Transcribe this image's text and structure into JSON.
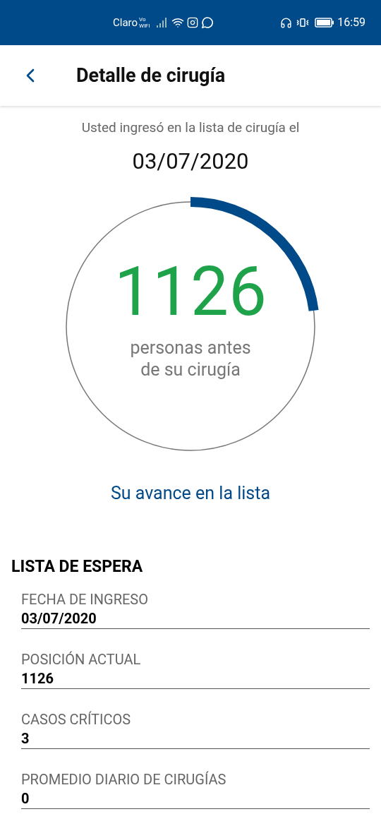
{
  "status_bar": {
    "carrier": "Claro",
    "wifi_calling": "Vo WiFi",
    "time": "16:59"
  },
  "app_bar": {
    "title": "Detalle de cirugía"
  },
  "intro": "Usted ingresó en la lista de cirugía el",
  "date": "03/07/2020",
  "progress": {
    "count": "1126",
    "caption_lines": [
      "personas antes",
      "de su cirugía"
    ]
  },
  "link": "Su avance en la lista",
  "section_title": "LISTA DE ESPERA",
  "fields": [
    {
      "label": "FECHA DE INGRESO",
      "value": "03/07/2020"
    },
    {
      "label": "POSICIÓN ACTUAL",
      "value": "1126"
    },
    {
      "label": "CASOS CRÍTICOS",
      "value": "3"
    },
    {
      "label": "PROMEDIO DIARIO DE CIRUGÍAS",
      "value": "0"
    }
  ]
}
